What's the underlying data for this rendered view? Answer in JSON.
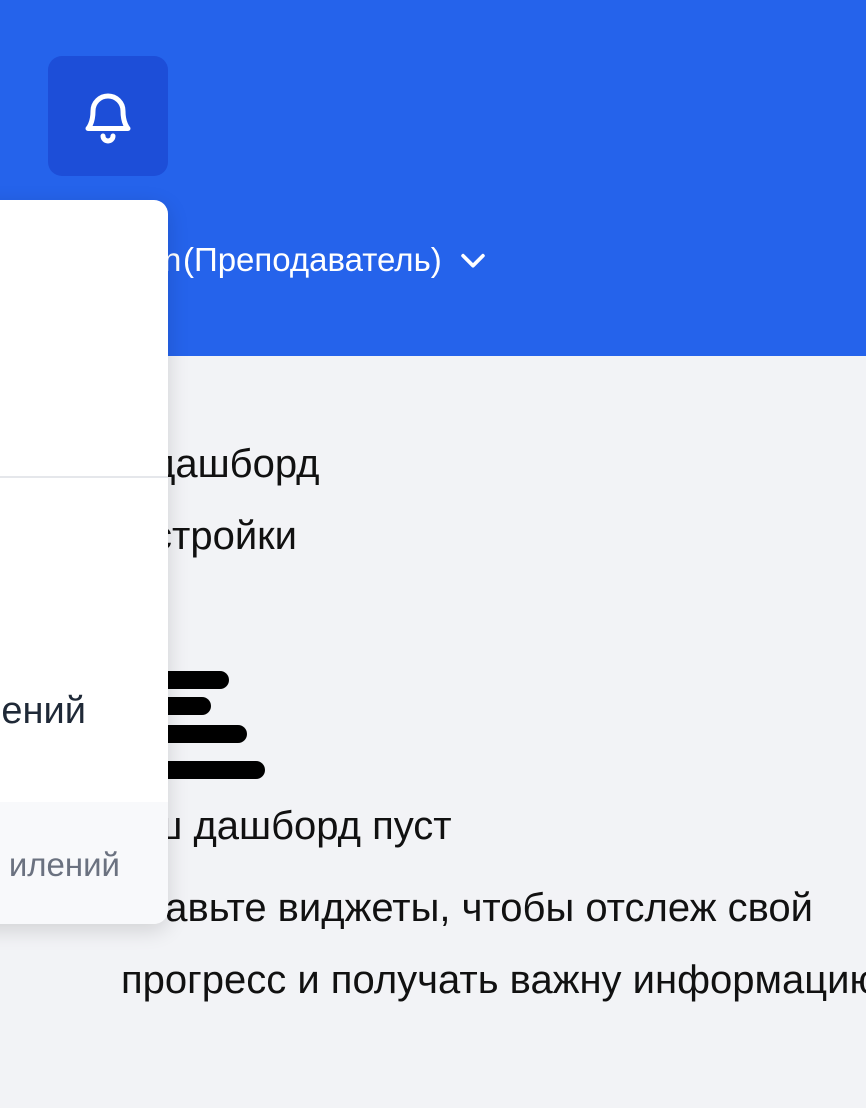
{
  "header": {
    "role_label": "(Преподаватель)",
    "name_fragment": "n",
    "bell_icon": "bell-icon",
    "chevron_icon": "chevron-down-icon"
  },
  "nav": {
    "dashboard": "дашборд",
    "settings": "стройки"
  },
  "empty_state": {
    "icon": "bars-icon",
    "title": "аш дашборд пуст",
    "description": "обавьте виджеты, чтобы отслеж свой прогресс и получать важну информацию"
  },
  "dropdown": {
    "item_label": "ений",
    "footer_label": "илений"
  },
  "colors": {
    "header_bg": "#2563eb",
    "bell_button_bg": "#1d4ed8",
    "page_bg": "#f2f3f6"
  }
}
